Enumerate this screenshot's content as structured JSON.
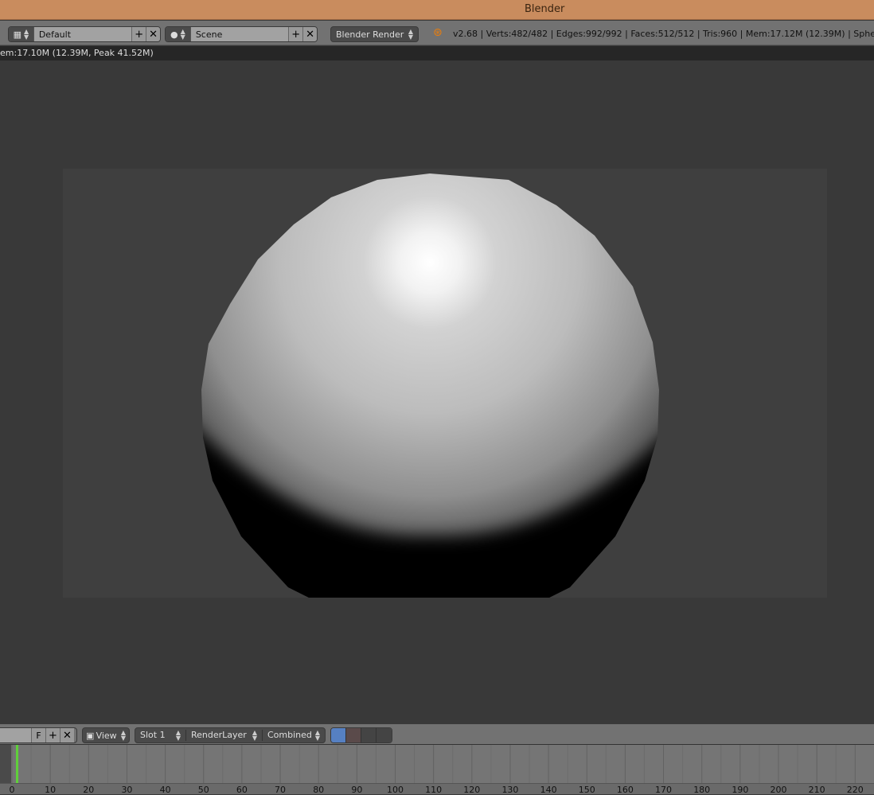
{
  "window": {
    "title": "Blender"
  },
  "header": {
    "screen_layout": "Default",
    "scene": "Scene",
    "render_engine": "Blender Render",
    "info": "v2.68 | Verts:482/482 | Edges:992/992 | Faces:512/512 | Tris:960 | Mem:17.12M (12.39M) | Sphere"
  },
  "render_status": "em:17.10M (12.39M, Peak 41.52M)",
  "image_editor": {
    "frame_button": "F",
    "view_menu": "View",
    "slot": "Slot 1",
    "render_layer": "RenderLayer",
    "pass": "Combined"
  },
  "timeline": {
    "current_frame": 1,
    "frame_color": "#5fcf3a",
    "ticks": [
      "0",
      "10",
      "20",
      "30",
      "40",
      "50",
      "60",
      "70",
      "80",
      "90",
      "100",
      "110",
      "120",
      "130",
      "140",
      "150",
      "160",
      "170",
      "180",
      "190",
      "200",
      "210",
      "220"
    ]
  }
}
